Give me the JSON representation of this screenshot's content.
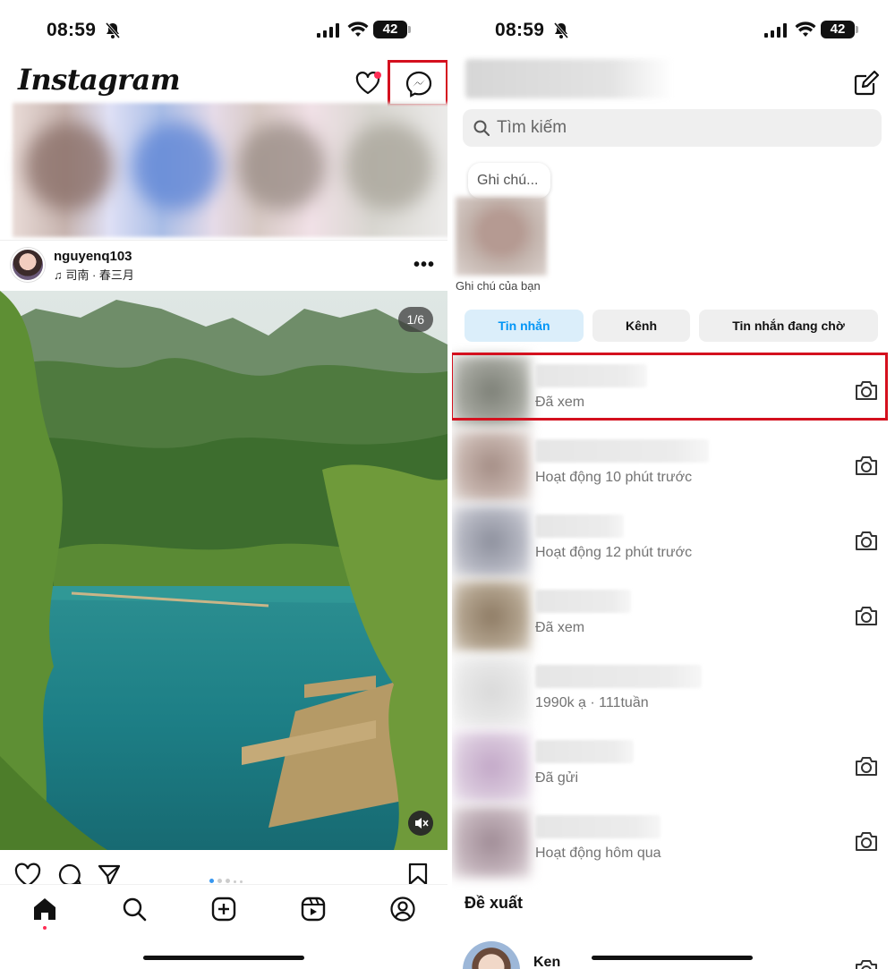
{
  "left": {
    "status": {
      "time": "08:59",
      "battery": "42"
    },
    "app": {
      "logo": "Instagram"
    },
    "header_icons": [
      "heart-icon",
      "messenger-icon"
    ],
    "post": {
      "username": "nguyenq103",
      "music": "♫ 司南 · 春三月",
      "page_indicator": "1/6",
      "more": "•••"
    },
    "bottom_nav": [
      "home-icon",
      "search-icon",
      "create-icon",
      "reels-icon",
      "profile-icon"
    ]
  },
  "right": {
    "status": {
      "time": "08:59",
      "battery": "42"
    },
    "search": {
      "placeholder": "Tìm kiếm"
    },
    "note": {
      "bubble": "Ghi chú...",
      "caption": "Ghi chú của bạn"
    },
    "tabs": [
      {
        "label": "Tin nhắn",
        "active": true
      },
      {
        "label": "Kênh",
        "active": false
      },
      {
        "label": "Tin nhắn đang chờ",
        "active": false
      }
    ],
    "conversations": [
      {
        "subtitle": "Đã xem",
        "camera": true
      },
      {
        "subtitle": "Hoạt động 10 phút trước",
        "camera": true
      },
      {
        "subtitle": "Hoạt động 12 phút trước",
        "camera": true
      },
      {
        "subtitle": "Đã xem",
        "camera": true
      },
      {
        "subtitle": "1990k ạ · 111tuần",
        "camera": false
      },
      {
        "subtitle": "Đã gửi",
        "camera": true
      },
      {
        "subtitle": "Hoạt động hôm qua",
        "camera": true
      }
    ],
    "suggestions": {
      "title": "Đề xuất",
      "first_name": "Ken"
    }
  },
  "colors": {
    "highlight_box": "#d4101e",
    "active_tab_text": "#0095f6",
    "active_tab_bg": "#dbeefa"
  }
}
